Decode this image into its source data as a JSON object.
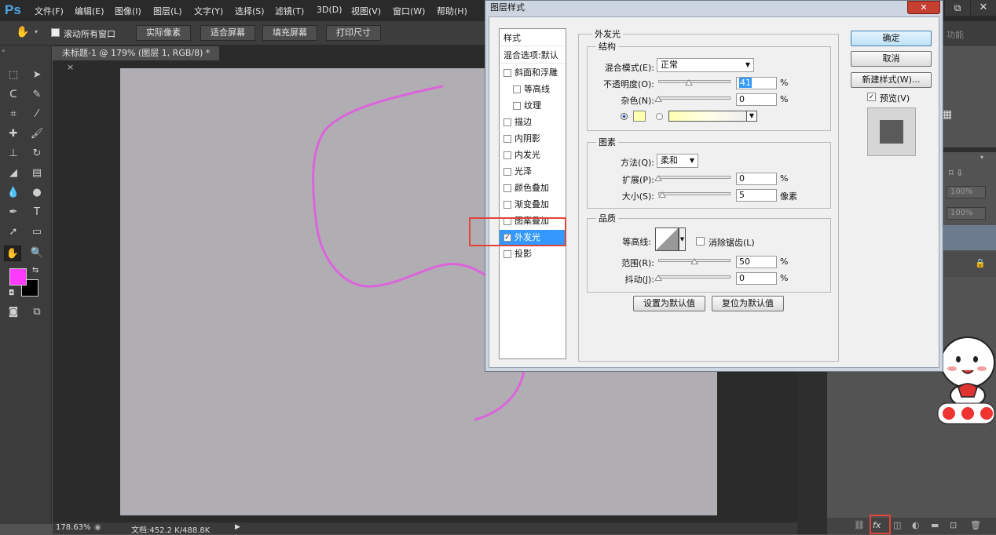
{
  "app": {
    "logo": "Ps"
  },
  "menu": [
    "文件(F)",
    "编辑(E)",
    "图像(I)",
    "图层(L)",
    "文字(Y)",
    "选择(S)",
    "滤镜(T)",
    "3D(D)",
    "视图(V)",
    "窗口(W)",
    "帮助(H)"
  ],
  "options_bar": {
    "scroll_all_label": "滚动所有窗口",
    "buttons": [
      "实际像素",
      "适合屏幕",
      "填充屏幕",
      "打印尺寸"
    ]
  },
  "document": {
    "tab_title": "未标题-1 @ 179% (图层 1, RGB/8) *",
    "tab_close": "×"
  },
  "statusbar": {
    "zoom": "178.63%",
    "doc_info": "文档:452.2 K/488.8K"
  },
  "colors": {
    "foreground": "#ff3bff",
    "background": "#000000",
    "canvas": "#b1aeb3",
    "stroke": "#e15be0"
  },
  "right_panel": {
    "workspace": "功能",
    "opacity_label": "度:",
    "opacity_value": "100%",
    "fill_label": "充:",
    "fill_value": "100%"
  },
  "dialog": {
    "title": "图层样式",
    "close": "✕",
    "style_list": [
      {
        "label": "样式",
        "checkbox": false,
        "indent": false,
        "checked": false,
        "selected": false
      },
      {
        "label": "混合选项:默认",
        "checkbox": false,
        "indent": false,
        "checked": false,
        "selected": false
      },
      {
        "label": "斜面和浮雕",
        "checkbox": true,
        "indent": false,
        "checked": false,
        "selected": false
      },
      {
        "label": "等高线",
        "checkbox": true,
        "indent": true,
        "checked": false,
        "selected": false
      },
      {
        "label": "纹理",
        "checkbox": true,
        "indent": true,
        "checked": false,
        "selected": false
      },
      {
        "label": "描边",
        "checkbox": true,
        "indent": false,
        "checked": false,
        "selected": false
      },
      {
        "label": "内阴影",
        "checkbox": true,
        "indent": false,
        "checked": false,
        "selected": false
      },
      {
        "label": "内发光",
        "checkbox": true,
        "indent": false,
        "checked": false,
        "selected": false
      },
      {
        "label": "光泽",
        "checkbox": true,
        "indent": false,
        "checked": false,
        "selected": false
      },
      {
        "label": "颜色叠加",
        "checkbox": true,
        "indent": false,
        "checked": false,
        "selected": false
      },
      {
        "label": "渐变叠加",
        "checkbox": true,
        "indent": false,
        "checked": false,
        "selected": false
      },
      {
        "label": "图案叠加",
        "checkbox": true,
        "indent": false,
        "checked": false,
        "selected": false
      },
      {
        "label": "外发光",
        "checkbox": true,
        "indent": false,
        "checked": true,
        "selected": true
      },
      {
        "label": "投影",
        "checkbox": true,
        "indent": false,
        "checked": false,
        "selected": false
      }
    ],
    "section_title": "外发光",
    "structure": {
      "title": "结构",
      "blend_mode_label": "混合模式(E):",
      "blend_mode_value": "正常",
      "opacity_label": "不透明度(O):",
      "opacity_value": "41",
      "noise_label": "杂色(N):",
      "noise_value": "0",
      "percent": "%",
      "glow_color": "#ffffb0"
    },
    "elements": {
      "title": "图素",
      "method_label": "方法(Q):",
      "method_value": "柔和",
      "spread_label": "扩展(P):",
      "spread_value": "0",
      "size_label": "大小(S):",
      "size_value": "5",
      "size_unit": "像素",
      "percent": "%"
    },
    "quality": {
      "title": "品质",
      "contour_label": "等高线:",
      "antialias_label": "消除锯齿(L)",
      "range_label": "范围(R):",
      "range_value": "50",
      "jitter_label": "抖动(J):",
      "jitter_value": "0",
      "percent": "%"
    },
    "buttons": {
      "set_default": "设置为默认值",
      "reset_default": "复位为默认值",
      "ok": "确定",
      "cancel": "取消",
      "new_style": "新建样式(W)...",
      "preview": "预览(V)"
    }
  }
}
